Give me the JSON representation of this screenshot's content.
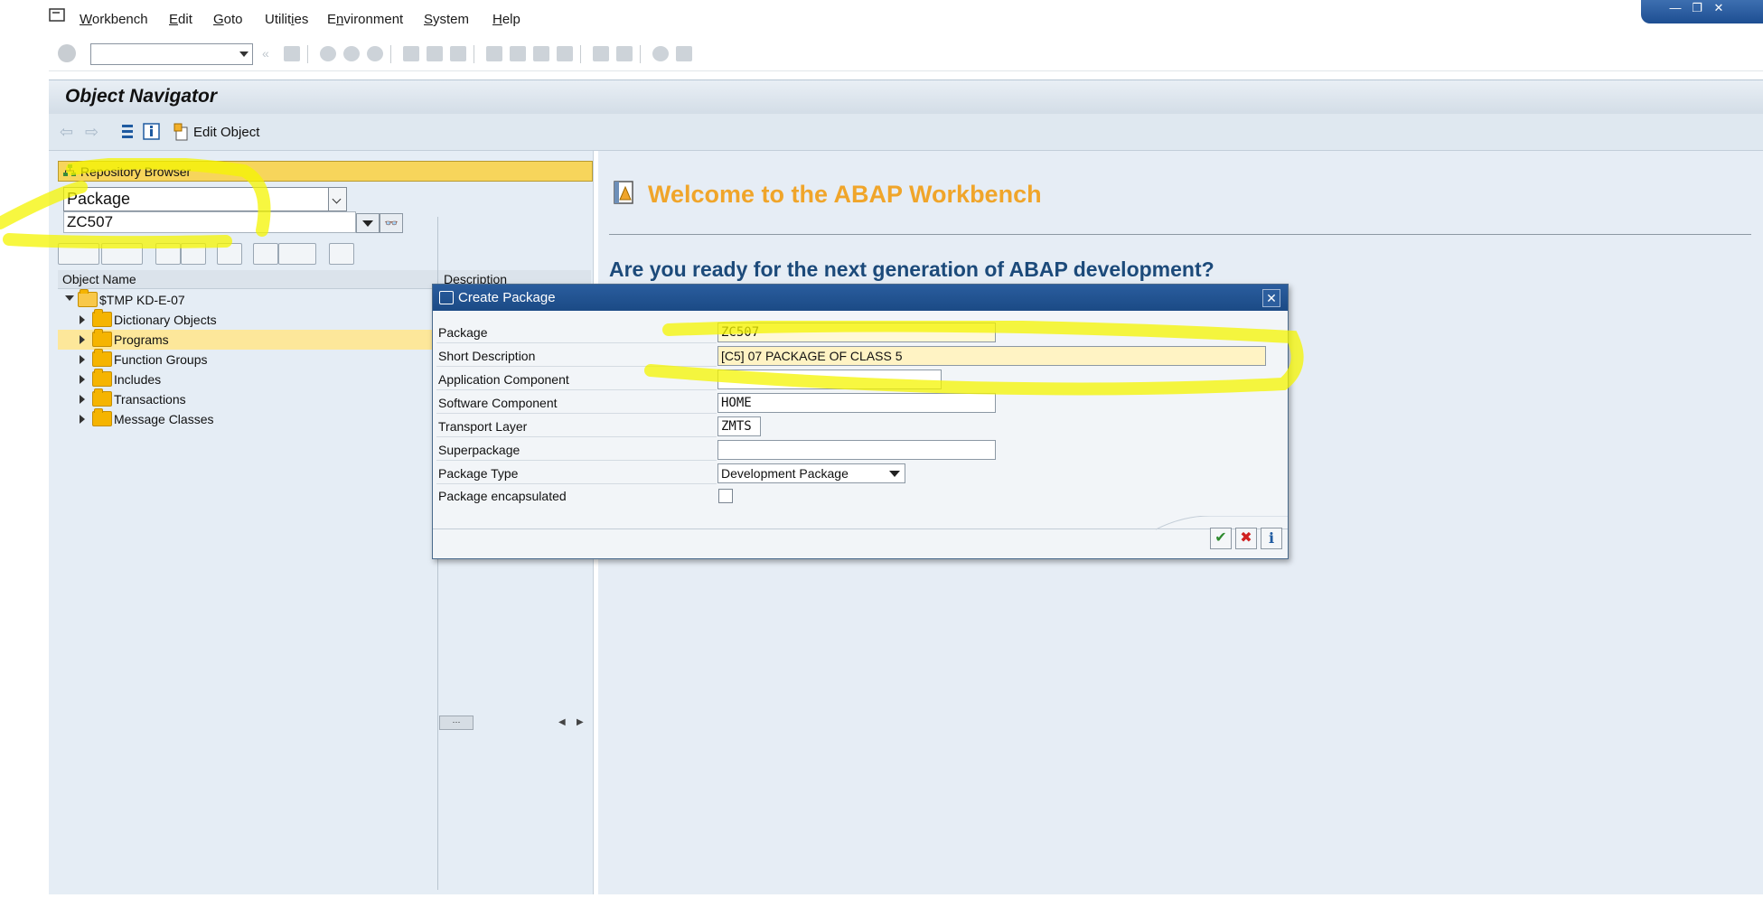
{
  "menubar": {
    "items": [
      {
        "id": "workbench",
        "pre": "",
        "u": "W",
        "post": "orkbench"
      },
      {
        "id": "edit",
        "pre": "",
        "u": "E",
        "post": "dit"
      },
      {
        "id": "goto",
        "pre": "",
        "u": "G",
        "post": "oto"
      },
      {
        "id": "utilities",
        "pre": "Utilit",
        "u": "i",
        "post": "es"
      },
      {
        "id": "environment",
        "pre": "E",
        "u": "n",
        "post": "vironment"
      },
      {
        "id": "system",
        "pre": "",
        "u": "S",
        "post": "ystem"
      },
      {
        "id": "help",
        "pre": "",
        "u": "H",
        "post": "elp"
      }
    ]
  },
  "window_controls": {
    "minimize": "—",
    "restore": "❐",
    "close": "✕"
  },
  "title": "Object Navigator",
  "app_toolbar": {
    "edit_object_label": "Edit Object"
  },
  "repository": {
    "header": "Repository Browser",
    "object_type": "Package",
    "object_name": "ZC507"
  },
  "tree": {
    "col_name": "Object Name",
    "col_desc": "Description",
    "root": "$TMP KD-E-07",
    "nodes": [
      {
        "label": "Dictionary Objects",
        "selected": false
      },
      {
        "label": "Programs",
        "selected": true
      },
      {
        "label": "Function Groups",
        "selected": false
      },
      {
        "label": "Includes",
        "selected": false
      },
      {
        "label": "Transactions",
        "selected": false
      },
      {
        "label": "Message Classes",
        "selected": false
      }
    ]
  },
  "welcome": {
    "title": "Welcome to the ABAP Workbench",
    "subtitle": "Are you ready for the next generation of ABAP development?"
  },
  "dialog": {
    "title": "Create Package",
    "fields": {
      "package": {
        "label": "Package",
        "value": "ZC507"
      },
      "short_description": {
        "label": "Short Description",
        "value": "[C5] 07 PACKAGE OF CLASS 5"
      },
      "application_component": {
        "label": "Application Component",
        "value": ""
      },
      "software_component": {
        "label": "Software Component",
        "value": "HOME"
      },
      "transport_layer": {
        "label": "Transport Layer",
        "value": "ZMTS"
      },
      "superpackage": {
        "label": "Superpackage",
        "value": ""
      },
      "package_type": {
        "label": "Package Type",
        "value": "Development Package"
      },
      "package_encapsulated": {
        "label": "Package encapsulated",
        "checked": false
      }
    }
  },
  "colors": {
    "highlighter": "#f4f400",
    "repo_header": "#f7d55b",
    "welcome_title": "#f0a52a",
    "dialog_title_bar": "#1b4a85",
    "ready_text": "#1c4a7a"
  }
}
